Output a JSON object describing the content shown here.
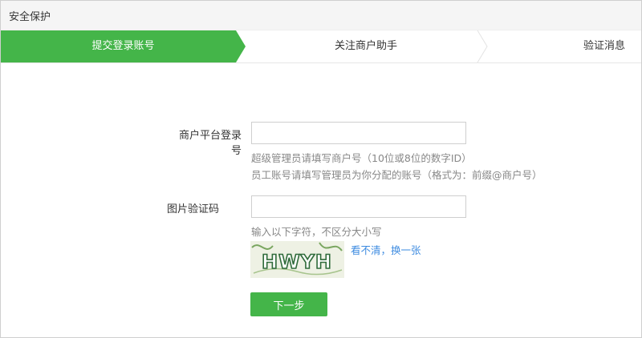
{
  "titlebar": {
    "title": "安全保护"
  },
  "steps": [
    {
      "label": "提交登录账号",
      "active": true
    },
    {
      "label": "关注商户助手",
      "active": false
    },
    {
      "label": "验证消息",
      "active": false
    }
  ],
  "form": {
    "account": {
      "label": "商户平台登录号",
      "value": "",
      "hint1": "超级管理员请填写商户号（10位或8位的数字ID）",
      "hint2": "员工账号请填写管理员为你分配的账号（格式为：前缀@商户号）"
    },
    "captcha": {
      "label": "图片验证码",
      "value": "",
      "hint": "输入以下字符，不区分大小写",
      "image_text": "HWYH",
      "refresh_label": "看不清，换一张"
    },
    "next_label": "下一步"
  },
  "colors": {
    "accent": "#44b549",
    "link": "#3d8be0"
  }
}
